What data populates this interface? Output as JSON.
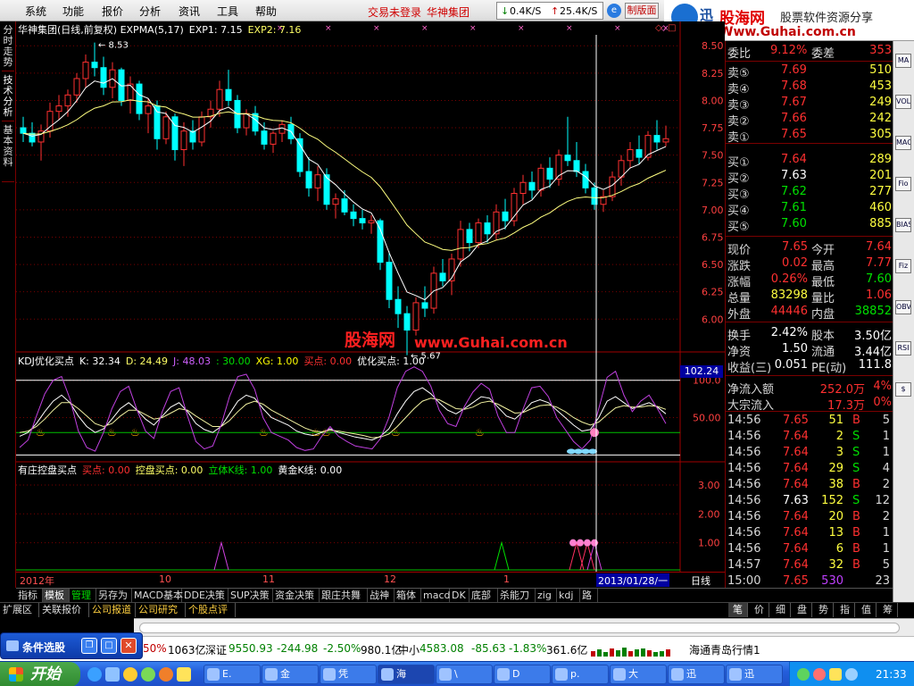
{
  "menubar": {
    "items": [
      "系统",
      "功能",
      "报价",
      "分析",
      "资讯",
      "工具",
      "帮助"
    ],
    "status_text": "交易未登录",
    "stock_name": "华神集团",
    "down_speed": "0.4K/S",
    "up_speed": "25.4K/S",
    "version_btn": "制版面"
  },
  "banner": {
    "logo_text": "迅",
    "site_cn": "股海网",
    "slogan": "股票软件资源分享",
    "url": "Www.Guhai.com.cn"
  },
  "left_tabs": [
    "分时走势",
    "技术分析",
    "基本资料"
  ],
  "main_chart": {
    "title": "华神集团(日线,前复权) EXPMA(5,17)",
    "exp1": "EXP1: 7.15",
    "exp2": "EXP2: 7.16",
    "high_label": "8.53",
    "low_label": "5.67"
  },
  "kdj_panel": {
    "title": "KDJ优化买点",
    "k": "K: 32.34",
    "d": "D: 24.49",
    "j": "J: 48.03",
    "thirty": ": 30.00",
    "xg": "XG: 1.00",
    "buy": "买点: 0.00",
    "opt": "优化买点: 1.00",
    "readout": "102.24"
  },
  "zhuang_panel": {
    "title": "有庄控盘买点",
    "buy": "买点: 0.00",
    "ctrl": "控盘买点: 0.00",
    "liti": "立体K线: 1.00",
    "gold": "黄金K线: 0.00"
  },
  "watermark": {
    "cn": "股海网",
    "url": "www.Guhai.com.cn"
  },
  "time_axis": {
    "labels": [
      "2012年",
      "10",
      "11",
      "12",
      "1"
    ],
    "cursor_date": "2013/01/28/一",
    "period": "日线"
  },
  "chart_data": [
    {
      "type": "candlestick",
      "name": "price",
      "y_ticks": [
        "8.50",
        "8.25",
        "8.00",
        "7.75",
        "7.50",
        "7.25",
        "7.00",
        "6.75",
        "6.50",
        "6.25",
        "6.00"
      ],
      "ylim": [
        5.7,
        8.6
      ],
      "candles": [
        [
          7.75,
          7.85,
          7.62,
          7.7
        ],
        [
          7.7,
          7.8,
          7.58,
          7.62
        ],
        [
          7.62,
          7.78,
          7.45,
          7.72
        ],
        [
          7.72,
          7.98,
          7.66,
          7.9
        ],
        [
          7.9,
          8.05,
          7.82,
          7.95
        ],
        [
          7.95,
          8.1,
          7.85,
          8.05
        ],
        [
          8.05,
          8.25,
          7.98,
          8.2
        ],
        [
          8.2,
          8.42,
          8.12,
          8.35
        ],
        [
          8.35,
          8.53,
          8.22,
          8.3
        ],
        [
          8.3,
          8.4,
          8.05,
          8.12
        ],
        [
          8.12,
          8.35,
          8.02,
          8.28
        ],
        [
          8.28,
          8.3,
          7.95,
          8.0
        ],
        [
          8.0,
          8.22,
          7.88,
          8.15
        ],
        [
          8.15,
          8.18,
          7.82,
          7.88
        ],
        [
          7.88,
          8.02,
          7.7,
          7.95
        ],
        [
          7.95,
          8.0,
          7.55,
          7.65
        ],
        [
          7.65,
          7.9,
          7.6,
          7.85
        ],
        [
          7.85,
          7.88,
          7.45,
          7.55
        ],
        [
          7.55,
          7.8,
          7.4,
          7.72
        ],
        [
          7.72,
          7.82,
          7.55,
          7.62
        ],
        [
          7.62,
          7.9,
          7.58,
          7.85
        ],
        [
          7.85,
          8.0,
          7.75,
          7.92
        ],
        [
          7.92,
          8.18,
          7.85,
          8.1
        ],
        [
          8.1,
          8.28,
          7.95,
          8.0
        ],
        [
          8.0,
          8.05,
          7.7,
          7.75
        ],
        [
          7.75,
          7.92,
          7.68,
          7.88
        ],
        [
          7.88,
          7.95,
          7.68,
          7.72
        ],
        [
          7.72,
          7.8,
          7.55,
          7.6
        ],
        [
          7.6,
          7.72,
          7.52,
          7.7
        ],
        [
          7.7,
          7.82,
          7.62,
          7.78
        ],
        [
          7.78,
          7.85,
          7.6,
          7.65
        ],
        [
          7.65,
          7.7,
          7.3,
          7.35
        ],
        [
          7.35,
          7.48,
          7.12,
          7.2
        ],
        [
          7.2,
          7.4,
          7.08,
          7.32
        ],
        [
          7.32,
          7.38,
          7.0,
          7.05
        ],
        [
          7.05,
          7.15,
          6.92,
          7.1
        ],
        [
          7.1,
          7.18,
          6.95,
          6.98
        ],
        [
          6.98,
          7.05,
          6.85,
          6.92
        ],
        [
          6.92,
          7.0,
          6.82,
          6.88
        ],
        [
          6.88,
          6.95,
          6.78,
          6.9
        ],
        [
          6.9,
          6.92,
          6.45,
          6.52
        ],
        [
          6.52,
          6.62,
          6.1,
          6.18
        ],
        [
          6.18,
          6.3,
          5.92,
          6.05
        ],
        [
          6.05,
          6.12,
          5.67,
          5.9
        ],
        [
          5.9,
          6.2,
          5.85,
          6.15
        ],
        [
          6.15,
          6.3,
          6.02,
          6.1
        ],
        [
          6.1,
          6.48,
          6.05,
          6.42
        ],
        [
          6.42,
          6.55,
          6.3,
          6.35
        ],
        [
          6.35,
          6.6,
          6.22,
          6.55
        ],
        [
          6.55,
          6.9,
          6.48,
          6.82
        ],
        [
          6.82,
          6.88,
          6.62,
          6.7
        ],
        [
          6.7,
          6.92,
          6.65,
          6.88
        ],
        [
          6.88,
          6.95,
          6.7,
          6.78
        ],
        [
          6.78,
          7.05,
          6.72,
          6.98
        ],
        [
          6.98,
          7.1,
          6.82,
          6.9
        ],
        [
          6.9,
          7.2,
          6.85,
          7.15
        ],
        [
          7.15,
          7.32,
          7.05,
          7.25
        ],
        [
          7.25,
          7.35,
          7.1,
          7.18
        ],
        [
          7.18,
          7.42,
          7.12,
          7.38
        ],
        [
          7.38,
          7.48,
          7.2,
          7.28
        ],
        [
          7.28,
          7.55,
          7.22,
          7.5
        ],
        [
          7.5,
          7.85,
          7.4,
          7.45
        ],
        [
          7.45,
          7.62,
          7.3,
          7.35
        ],
        [
          7.35,
          7.42,
          7.15,
          7.2
        ],
        [
          7.2,
          7.25,
          7.0,
          7.05
        ],
        [
          7.05,
          7.18,
          6.98,
          7.12
        ],
        [
          7.12,
          7.35,
          7.08,
          7.3
        ],
        [
          7.3,
          7.5,
          7.22,
          7.45
        ],
        [
          7.45,
          7.62,
          7.38,
          7.55
        ],
        [
          7.55,
          7.68,
          7.42,
          7.48
        ],
        [
          7.48,
          7.72,
          7.45,
          7.68
        ],
        [
          7.68,
          7.82,
          7.55,
          7.62
        ],
        [
          7.62,
          7.77,
          7.58,
          7.65
        ]
      ]
    },
    {
      "type": "line",
      "name": "KDJ",
      "y_ticks": [
        "100.0",
        "50.00"
      ],
      "ylim": [
        -8,
        120
      ],
      "series": [
        {
          "name": "K",
          "color": "#ffffff",
          "values": [
            25,
            30,
            42,
            58,
            72,
            80,
            70,
            52,
            38,
            30,
            35,
            48,
            62,
            70,
            60,
            48,
            40,
            52,
            64,
            70,
            58,
            42,
            34,
            30,
            38,
            55,
            72,
            80,
            76,
            62,
            50,
            45,
            40,
            32,
            28,
            26,
            30,
            35,
            30,
            27,
            24,
            22,
            20,
            25,
            35,
            55,
            72,
            85,
            90,
            82,
            70,
            60,
            55,
            62,
            70,
            78,
            76,
            64,
            52,
            48,
            58,
            70,
            74,
            70,
            60,
            50,
            40,
            32,
            34,
            50,
            72,
            78,
            70,
            62,
            66,
            70,
            64,
            55
          ]
        },
        {
          "name": "D",
          "color": "#f0f0a0",
          "values": [
            30,
            32,
            38,
            48,
            60,
            70,
            70,
            62,
            52,
            42,
            38,
            42,
            52,
            60,
            60,
            54,
            48,
            50,
            56,
            62,
            60,
            52,
            45,
            38,
            38,
            46,
            58,
            68,
            72,
            68,
            60,
            54,
            48,
            42,
            36,
            32,
            31,
            33,
            32,
            30,
            28,
            26,
            23,
            24,
            28,
            38,
            50,
            62,
            72,
            76,
            74,
            68,
            62,
            61,
            64,
            70,
            72,
            68,
            62,
            56,
            57,
            62,
            66,
            67,
            64,
            58,
            50,
            44,
            40,
            44,
            54,
            63,
            66,
            64,
            64,
            66,
            65,
            61
          ]
        },
        {
          "name": "J",
          "color": "#c040e0",
          "values": [
            10,
            20,
            52,
            82,
            100,
            105,
            75,
            32,
            10,
            5,
            30,
            62,
            85,
            92,
            60,
            32,
            22,
            58,
            85,
            90,
            52,
            18,
            8,
            12,
            40,
            78,
            105,
            108,
            88,
            50,
            30,
            25,
            20,
            10,
            6,
            8,
            25,
            38,
            25,
            18,
            12,
            10,
            8,
            22,
            50,
            90,
            112,
            118,
            112,
            92,
            60,
            42,
            38,
            65,
            84,
            96,
            88,
            52,
            30,
            30,
            62,
            90,
            92,
            78,
            50,
            34,
            18,
            8,
            20,
            62,
            104,
            112,
            80,
            58,
            72,
            80,
            62,
            42
          ]
        }
      ],
      "ref_line": 30
    },
    {
      "type": "line",
      "name": "zhuang",
      "y_ticks": [
        "3.00",
        "2.00",
        "1.00"
      ],
      "ylim": [
        0,
        3.4
      ]
    }
  ],
  "quote": {
    "wei_bi_label": "委比",
    "wei_bi_value": "9.12%",
    "wei_cha_label": "委差",
    "wei_cha_value": "353",
    "asks": [
      {
        "label": "卖⑤",
        "price": "7.69",
        "vol": "510"
      },
      {
        "label": "卖④",
        "price": "7.68",
        "vol": "453"
      },
      {
        "label": "卖③",
        "price": "7.67",
        "vol": "249"
      },
      {
        "label": "卖②",
        "price": "7.66",
        "vol": "242"
      },
      {
        "label": "卖①",
        "price": "7.65",
        "vol": "305"
      }
    ],
    "bids": [
      {
        "label": "买①",
        "price": "7.64",
        "vol": "289"
      },
      {
        "label": "买②",
        "price": "7.63",
        "vol": "201"
      },
      {
        "label": "买③",
        "price": "7.62",
        "vol": "277"
      },
      {
        "label": "买④",
        "price": "7.61",
        "vol": "460"
      },
      {
        "label": "买⑤",
        "price": "7.60",
        "vol": "885"
      }
    ],
    "stats": [
      {
        "l1": "现价",
        "v1": "7.65",
        "l2": "今开",
        "v2": "7.64"
      },
      {
        "l1": "涨跌",
        "v1": "0.02",
        "l2": "最高",
        "v2": "7.77"
      },
      {
        "l1": "涨幅",
        "v1": "0.26%",
        "l2": "最低",
        "v2": "7.60"
      },
      {
        "l1": "总量",
        "v1": "83298",
        "l2": "量比",
        "v2": "1.06"
      },
      {
        "l1": "外盘",
        "v1": "44446",
        "l2": "内盘",
        "v2": "38852"
      }
    ],
    "stats2": [
      {
        "l1": "换手",
        "v1": "2.42%",
        "l2": "股本",
        "v2": "3.50亿"
      },
      {
        "l1": "净资",
        "v1": "1.50",
        "l2": "流通",
        "v2": "3.44亿"
      },
      {
        "l1": "收益(三)",
        "v1": "0.051",
        "l2": "PE(动)",
        "v2": "111.8"
      }
    ],
    "flows": [
      {
        "label": "净流入额",
        "value": "252.0万",
        "pct": "4%"
      },
      {
        "label": "大宗流入",
        "value": "17.3万",
        "pct": "0%"
      }
    ],
    "ticks": [
      {
        "t": "14:56",
        "p": "7.65",
        "v": "51",
        "s": "B",
        "n": "5"
      },
      {
        "t": "14:56",
        "p": "7.64",
        "v": "2",
        "s": "S",
        "n": "1"
      },
      {
        "t": "14:56",
        "p": "7.64",
        "v": "3",
        "s": "S",
        "n": "1"
      },
      {
        "t": "14:56",
        "p": "7.64",
        "v": "29",
        "s": "S",
        "n": "4"
      },
      {
        "t": "14:56",
        "p": "7.64",
        "v": "38",
        "s": "B",
        "n": "2"
      },
      {
        "t": "14:56",
        "p": "7.63",
        "v": "152",
        "s": "S",
        "n": "12"
      },
      {
        "t": "14:56",
        "p": "7.64",
        "v": "20",
        "s": "B",
        "n": "2"
      },
      {
        "t": "14:56",
        "p": "7.64",
        "v": "13",
        "s": "B",
        "n": "1"
      },
      {
        "t": "14:56",
        "p": "7.64",
        "v": "6",
        "s": "B",
        "n": "1"
      },
      {
        "t": "14:57",
        "p": "7.64",
        "v": "32",
        "s": "B",
        "n": "5"
      },
      {
        "t": "15:00",
        "p": "7.65",
        "v": "530",
        "s": "",
        "n": "23"
      }
    ]
  },
  "bottom_tabs": [
    "指标",
    "模板",
    "管理",
    "另存为",
    "MACD基本",
    "DDE决策",
    "SUP决策",
    "资金决策",
    "跟庄共舞",
    "战神",
    "箱体",
    "macd",
    "DK",
    "底部",
    "杀能刀",
    "zig",
    "kdj",
    "路"
  ],
  "bottom_tabs2": [
    "扩展区",
    "关联报价",
    "公司报道",
    "公司研究",
    "个股点评"
  ],
  "right_bottom_tabs": [
    "笔",
    "价",
    "细",
    "盘",
    "势",
    "指",
    "值",
    "筹"
  ],
  "right_side_icons": [
    "MA",
    "VOL",
    "MACD",
    "Fio",
    "BIAS",
    "Fiz",
    "OBV",
    "RSI",
    "$"
  ],
  "ticker": {
    "t0": "50%",
    "t1": "1063亿",
    "t2": "深证",
    "t3": "9550.93",
    "t4": "-244.98",
    "t5": "-2.50%",
    "t6": "980.1亿",
    "t7": "中小",
    "t8": "4583.08",
    "t9": "-85.63",
    "t10": "-1.83%",
    "t11": "361.6亿",
    "t12": "海通青岛行情1"
  },
  "cond_window": "条件选股",
  "taskbar": {
    "start": "开始",
    "tasks": [
      "E.",
      "金",
      "凭",
      "海",
      "\\",
      "D",
      "p.",
      "大",
      "迅",
      "迅"
    ],
    "clock": "21:33"
  }
}
